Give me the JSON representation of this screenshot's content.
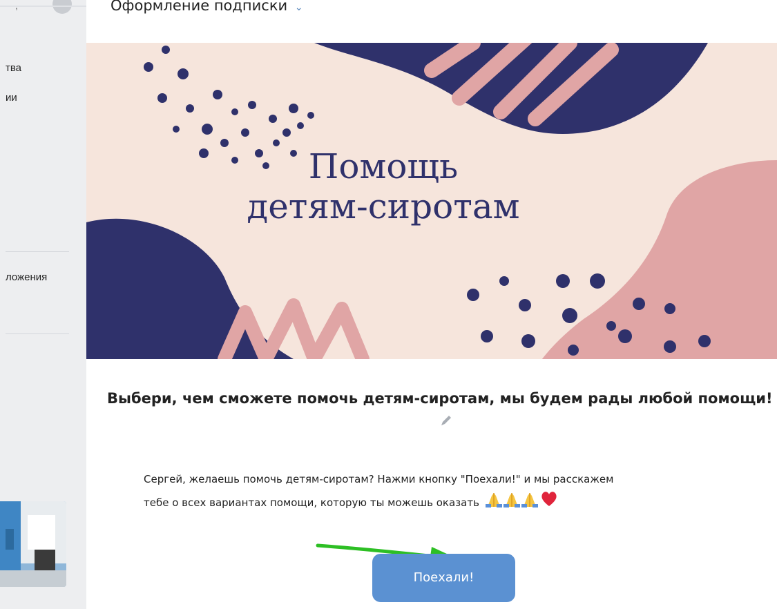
{
  "sidebar": {
    "partial_items": [
      {
        "label": "тва"
      },
      {
        "label": "ии"
      },
      {
        "label": "ложения"
      }
    ]
  },
  "header": {
    "title": "Оформление подписки"
  },
  "banner": {
    "title_line1": "Помощь",
    "title_line2": "детям-сиротам"
  },
  "content": {
    "headline": "Выбери, чем сможете помочь детям-сиротам, мы будем рады любой помощи!",
    "message_line1": "Сергей, желаешь помочь детям-сиротам? Нажми кнопку \"Поехали!\" и мы расскажем",
    "message_line2": "тебе о всех вариантах помощи, которую ты можешь оказать",
    "emoji": [
      "folded-hands",
      "folded-hands",
      "folded-hands",
      "red-heart"
    ]
  },
  "actions": {
    "go_button_label": "Поехали!"
  },
  "colors": {
    "banner_background": "#f6e5dc",
    "banner_navy": "#2f316b",
    "banner_pink": "#e0a5a5",
    "button_blue": "#5b91d2",
    "arrow_green": "#2dbf24"
  }
}
